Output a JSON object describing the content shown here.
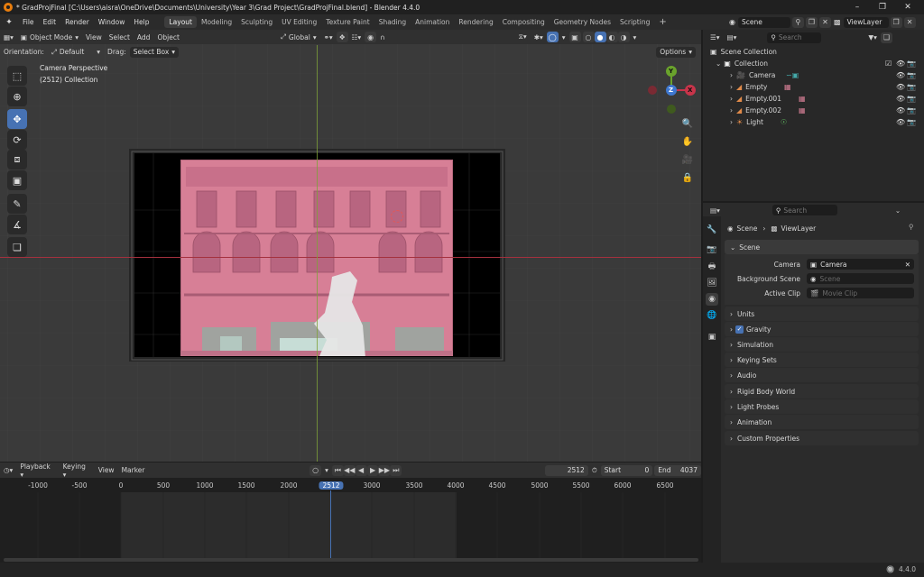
{
  "titlebar": {
    "text": "* GradProjFinal [C:\\Users\\aisra\\OneDrive\\Documents\\University\\Year 3\\Grad Project\\GradProjFinal.blend] - Blender 4.4.0"
  },
  "menu": [
    "File",
    "Edit",
    "Render",
    "Window",
    "Help"
  ],
  "workspaces": [
    "Layout",
    "Modeling",
    "Sculpting",
    "UV Editing",
    "Texture Paint",
    "Shading",
    "Animation",
    "Rendering",
    "Compositing",
    "Geometry Nodes",
    "Scripting"
  ],
  "active_workspace": "Layout",
  "scene_name": "Scene",
  "viewlayer_name": "ViewLayer",
  "viewport": {
    "mode": "Object Mode",
    "menus": [
      "View",
      "Select",
      "Add",
      "Object"
    ],
    "transform_orientation": "Global",
    "orientation_label": "Orientation:",
    "orientation_value": "Default",
    "drag_label": "Drag:",
    "drag_value": "Select Box",
    "options": "Options",
    "overlay_line1": "Camera Perspective",
    "overlay_line2": "(2512) Collection",
    "axis_x": "X",
    "axis_y": "Y",
    "axis_z": "Z"
  },
  "outliner": {
    "search_placeholder": "Search",
    "scene_collection": "Scene Collection",
    "collection": "Collection",
    "items": [
      {
        "name": "Camera",
        "icon": "camera-icon"
      },
      {
        "name": "Empty",
        "icon": "image-empty-icon"
      },
      {
        "name": "Empty.001",
        "icon": "image-empty-icon"
      },
      {
        "name": "Empty.002",
        "icon": "image-empty-icon"
      },
      {
        "name": "Light",
        "icon": "light-icon"
      }
    ]
  },
  "properties": {
    "search_placeholder": "Search",
    "breadcrumb_scene": "Scene",
    "breadcrumb_viewlayer": "ViewLayer",
    "section_scene": "Scene",
    "camera_label": "Camera",
    "camera_value": "Camera",
    "bg_scene_label": "Background Scene",
    "bg_scene_placeholder": "Scene",
    "active_clip_label": "Active Clip",
    "active_clip_placeholder": "Movie Clip",
    "panels": [
      "Units",
      "Gravity",
      "Simulation",
      "Keying Sets",
      "Audio",
      "Rigid Body World",
      "Light Probes",
      "Animation",
      "Custom Properties"
    ]
  },
  "timeline": {
    "menus": [
      "Playback",
      "Keying",
      "View",
      "Marker"
    ],
    "current_frame": "2512",
    "start_label": "Start",
    "start_value": "0",
    "end_label": "End",
    "end_value": "4037",
    "ticks": [
      "-1000",
      "-500",
      "0",
      "500",
      "1000",
      "1500",
      "2000",
      "2512",
      "3000",
      "3500",
      "4000",
      "4500",
      "5000",
      "5500",
      "6000",
      "6500"
    ]
  },
  "status": {
    "version": "4.4.0"
  },
  "colors": {
    "accent": "#4772b3",
    "selection": "#334d80",
    "image_tint": "#d77f96",
    "axis_x": "#c8344a",
    "axis_y": "#6aa32c",
    "axis_z": "#3f78d0"
  }
}
